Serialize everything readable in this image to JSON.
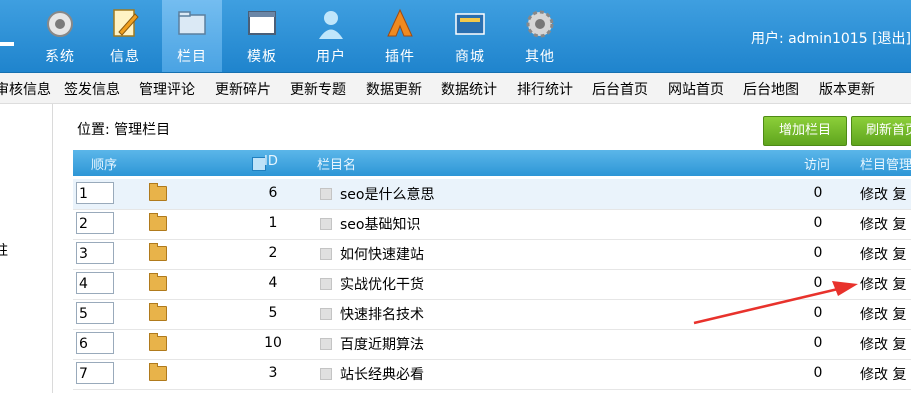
{
  "nav": {
    "items": [
      {
        "label": "系统",
        "icon": "system-gear-icon",
        "active": false
      },
      {
        "label": "信息",
        "icon": "info-edit-icon",
        "active": false
      },
      {
        "label": "栏目",
        "icon": "column-folder-icon",
        "active": true
      },
      {
        "label": "模板",
        "icon": "template-window-icon",
        "active": false
      },
      {
        "label": "用户",
        "icon": "user-icon",
        "active": false
      },
      {
        "label": "插件",
        "icon": "plugin-icon",
        "active": false
      },
      {
        "label": "商城",
        "icon": "shop-icon",
        "active": false
      },
      {
        "label": "其他",
        "icon": "other-gear-icon",
        "active": false
      }
    ],
    "user_text": "用户: admin1015  [退出]"
  },
  "menu": {
    "items": [
      "审核信息",
      "签发信息",
      "管理评论",
      "更新碎片",
      "更新专题",
      "数据更新",
      "数据统计",
      "排行统计",
      "后台首页",
      "网站首页",
      "后台地图",
      "版本更新"
    ]
  },
  "sidebar": {
    "fragment": "柱"
  },
  "main": {
    "location": "位置: 管理栏目",
    "buttons": {
      "add_column": "增加栏目",
      "refresh_home": "刷新首页"
    },
    "table": {
      "headers": {
        "order": "顺序",
        "id": "ID",
        "name": "栏目名",
        "visits": "访问",
        "manage": "栏目管理"
      },
      "rows": [
        {
          "order": "1",
          "id": "6",
          "name": "seo是什么意思",
          "visits": "0",
          "ops": "修改 复"
        },
        {
          "order": "2",
          "id": "1",
          "name": "seo基础知识",
          "visits": "0",
          "ops": "修改 复"
        },
        {
          "order": "3",
          "id": "2",
          "name": "如何快速建站",
          "visits": "0",
          "ops": "修改 复"
        },
        {
          "order": "4",
          "id": "4",
          "name": "实战优化干货",
          "visits": "0",
          "ops": "修改 复"
        },
        {
          "order": "5",
          "id": "5",
          "name": "快速排名技术",
          "visits": "0",
          "ops": "修改 复"
        },
        {
          "order": "6",
          "id": "10",
          "name": "百度近期算法",
          "visits": "0",
          "ops": "修改 复"
        },
        {
          "order": "7",
          "id": "3",
          "name": "站长经典必看",
          "visits": "0",
          "ops": "修改 复"
        }
      ]
    }
  },
  "colors": {
    "nav_bg": "#2a8fd6",
    "header_bg": "#3aa3e0",
    "button_green": "#6cb52a",
    "annotation_red": "#e8322c"
  }
}
